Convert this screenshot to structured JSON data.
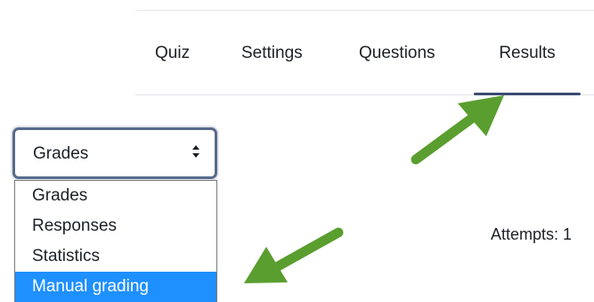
{
  "tabs": [
    {
      "label": "Quiz",
      "active": false
    },
    {
      "label": "Settings",
      "active": false
    },
    {
      "label": "Questions",
      "active": false
    },
    {
      "label": "Results",
      "active": true
    }
  ],
  "report_select": {
    "selected": "Grades",
    "options": [
      "Grades",
      "Responses",
      "Statistics",
      "Manual grading"
    ],
    "highlighted_option": "Manual grading"
  },
  "attempts_text": "Attempts: 1",
  "colors": {
    "active_tab_underline": "#3b4b73",
    "select_border": "#586a8c",
    "highlight": "#1e90ff",
    "arrow": "#5a9e2f"
  },
  "annotations": [
    "arrow-pointing-to-results-tab",
    "arrow-pointing-to-manual-grading"
  ]
}
